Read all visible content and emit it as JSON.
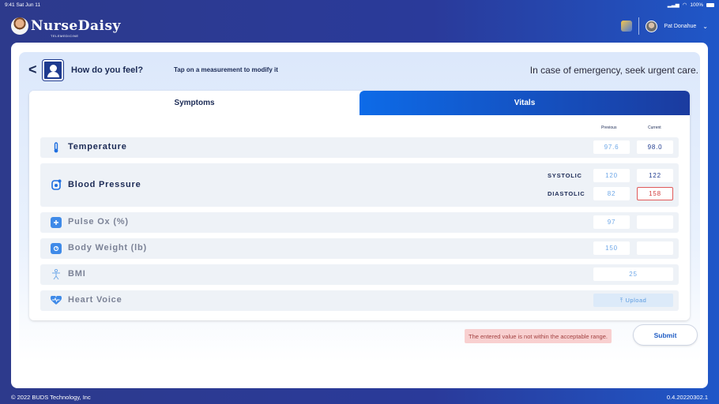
{
  "status_bar": {
    "time_date": "9:41  Sat Jun 11",
    "battery": "100%"
  },
  "header": {
    "brand": "NurseDaisy",
    "brand_sub": "TELEMEDICINE",
    "user_name": "Pat Donahue"
  },
  "page": {
    "title": "How do you feel?",
    "hint": "Tap on a measurement to modify it",
    "emergency": "In case of emergency, seek urgent care."
  },
  "tabs": {
    "symptoms": "Symptoms",
    "vitals": "Vitals"
  },
  "columns": {
    "previous": "Previous",
    "current": "Current"
  },
  "rows": {
    "temperature": {
      "label": "Temperature",
      "previous": "97.6",
      "current": "98.0"
    },
    "blood_pressure": {
      "label": "Blood Pressure",
      "systolic_label": "SYSTOLIC",
      "diastolic_label": "DIASTOLIC",
      "systolic_previous": "120",
      "systolic_current": "122",
      "diastolic_previous": "82",
      "diastolic_current": "158"
    },
    "pulse_ox": {
      "label": "Pulse Ox  (%)",
      "previous": "97",
      "current": ""
    },
    "body_weight": {
      "label": "Body Weight  (lb)",
      "previous": "150",
      "current": ""
    },
    "bmi": {
      "label": "BMI",
      "value": "25"
    },
    "heart_voice": {
      "label": "Heart Voice",
      "upload_label": "Upload"
    }
  },
  "error_message": "The entered value is not within the acceptable range.",
  "submit_label": "Submit",
  "footer": {
    "copyright": "© 2022 BUDS Technology, Inc",
    "version": "0.4.20220302.1"
  },
  "colors": {
    "accent": "#0d6be8",
    "navy": "#1b2a55",
    "error": "#e05a5a"
  },
  "icons": [
    "back-icon",
    "person-icon",
    "thermometer-icon",
    "blood-pressure-icon",
    "pulse-ox-icon",
    "scale-icon",
    "bmi-icon",
    "heart-voice-icon",
    "upload-icon"
  ]
}
